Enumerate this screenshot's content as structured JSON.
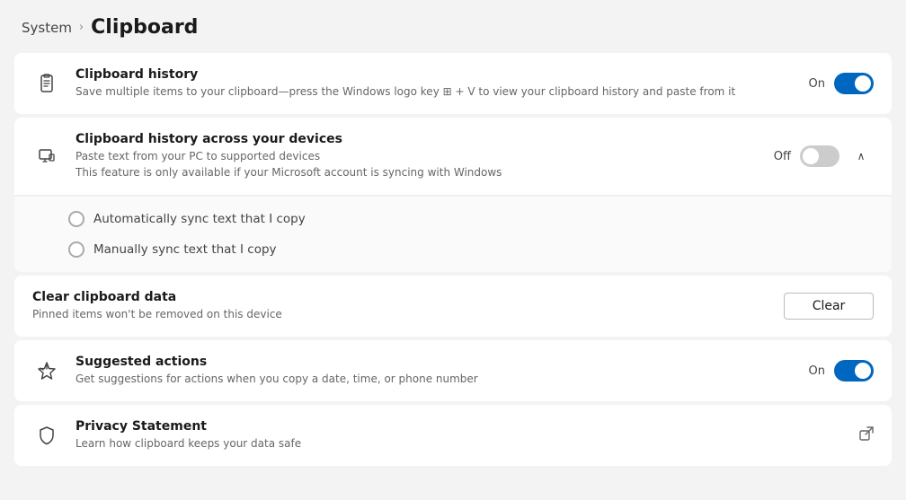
{
  "header": {
    "system_label": "System",
    "chevron": "›",
    "page_title": "Clipboard"
  },
  "sections": {
    "clipboard_history": {
      "title": "Clipboard history",
      "description": "Save multiple items to your clipboard—press the Windows logo key  + V to view your clipboard history and paste from it",
      "status_label": "On",
      "toggle_state": "on"
    },
    "clipboard_across_devices": {
      "title": "Clipboard history across your devices",
      "description_line1": "Paste text from your PC to supported devices",
      "description_line2": "This feature is only available if your Microsoft account is syncing with Windows",
      "status_label": "Off",
      "toggle_state": "off",
      "expanded": true,
      "radio_options": [
        {
          "id": "auto-sync",
          "label": "Automatically sync text that I copy"
        },
        {
          "id": "manual-sync",
          "label": "Manually sync text that I copy"
        }
      ]
    },
    "clear_clipboard": {
      "title": "Clear clipboard data",
      "description": "Pinned items won't be removed on this device",
      "button_label": "Clear"
    },
    "suggested_actions": {
      "title": "Suggested actions",
      "description": "Get suggestions for actions when you copy a date, time, or phone number",
      "status_label": "On",
      "toggle_state": "on"
    },
    "privacy_statement": {
      "title": "Privacy Statement",
      "description": "Learn how clipboard keeps your data safe"
    }
  }
}
